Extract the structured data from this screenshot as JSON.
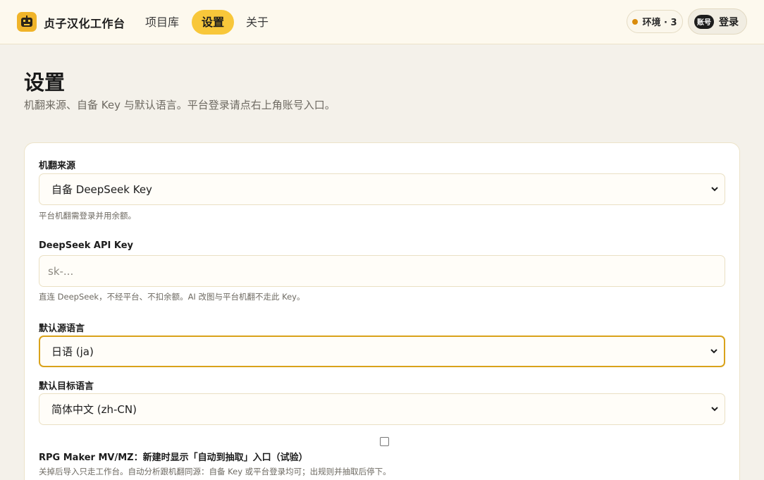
{
  "header": {
    "brand": "贞子汉化工作台",
    "nav": [
      {
        "label": "项目库",
        "active": false
      },
      {
        "label": "设置",
        "active": true
      },
      {
        "label": "关于",
        "active": false
      }
    ],
    "env_label": "环境 · 3",
    "account_badge": "账号",
    "login_label": "登录"
  },
  "page": {
    "title": "设置",
    "description": "机翻来源、自备 Key 与默认语言。平台登录请点右上角账号入口。"
  },
  "form": {
    "mt_source": {
      "label": "机翻来源",
      "value": "自备 DeepSeek Key",
      "hint": "平台机翻需登录并用余额。"
    },
    "api_key": {
      "label": "DeepSeek API Key",
      "placeholder": "sk-...",
      "value": "",
      "hint": "直连 DeepSeek，不经平台、不扣余额。AI 改图与平台机翻不走此 Key。"
    },
    "source_lang": {
      "label": "默认源语言",
      "value": "日语 (ja)"
    },
    "target_lang": {
      "label": "默认目标语言",
      "value": "简体中文 (zh-CN)"
    },
    "rpg_maker": {
      "checked": false,
      "label": "RPG Maker MV/MZ：新建时显示「自动到抽取」入口（试验）",
      "hint": "关掉后导入只走工作台。自动分析跟机翻同源：自备 Key 或平台登录均可；出规则并抽取后停下。"
    }
  },
  "colors": {
    "accent": "#f8c73a",
    "focus_border": "#d9a21a",
    "status_dot": "#d98b0b",
    "background": "#f4f1ea"
  }
}
